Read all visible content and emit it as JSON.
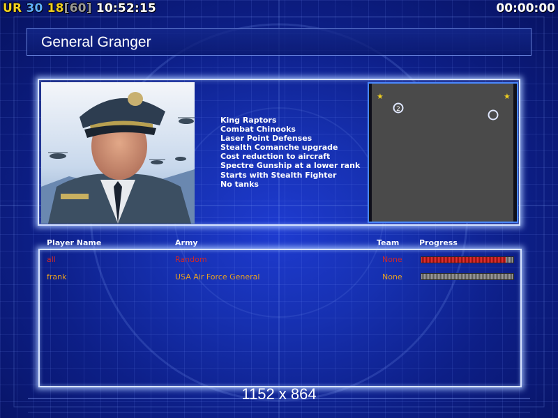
{
  "hud": {
    "ur_label": "UR",
    "value_30": "30",
    "value_18": "18",
    "value_60": "[60]",
    "clock": "10:52:15",
    "timer": "00:00:00"
  },
  "general": {
    "name": "General Granger",
    "perks": [
      "King Raptors",
      "Combat Chinooks",
      "Laser Point Defenses",
      "Stealth Comanche upgrade",
      "Cost reduction to aircraft",
      "Spectre Gunship at a lower rank",
      "Starts with Stealth Fighter",
      "No tanks"
    ]
  },
  "minimap": {
    "start_position_label": "2"
  },
  "players": {
    "headers": {
      "name": "Player Name",
      "army": "Army",
      "team": "Team",
      "progress": "Progress"
    },
    "rows": [
      {
        "name": "all",
        "army": "Random",
        "team": "None",
        "progress": 0.92,
        "color": "#d02828"
      },
      {
        "name": "frank",
        "army": "USA Air Force General",
        "team": "None",
        "progress": 0,
        "color": "#e8a020"
      }
    ]
  },
  "resolution": "1152 x 864",
  "colors": {
    "ur": "#f0d020",
    "v30": "#60b0ff",
    "v18": "#f0d020",
    "v60": "#9a9a9a",
    "panel_glow": "#d8e4ff",
    "minimap_border": "#4a88ff"
  }
}
